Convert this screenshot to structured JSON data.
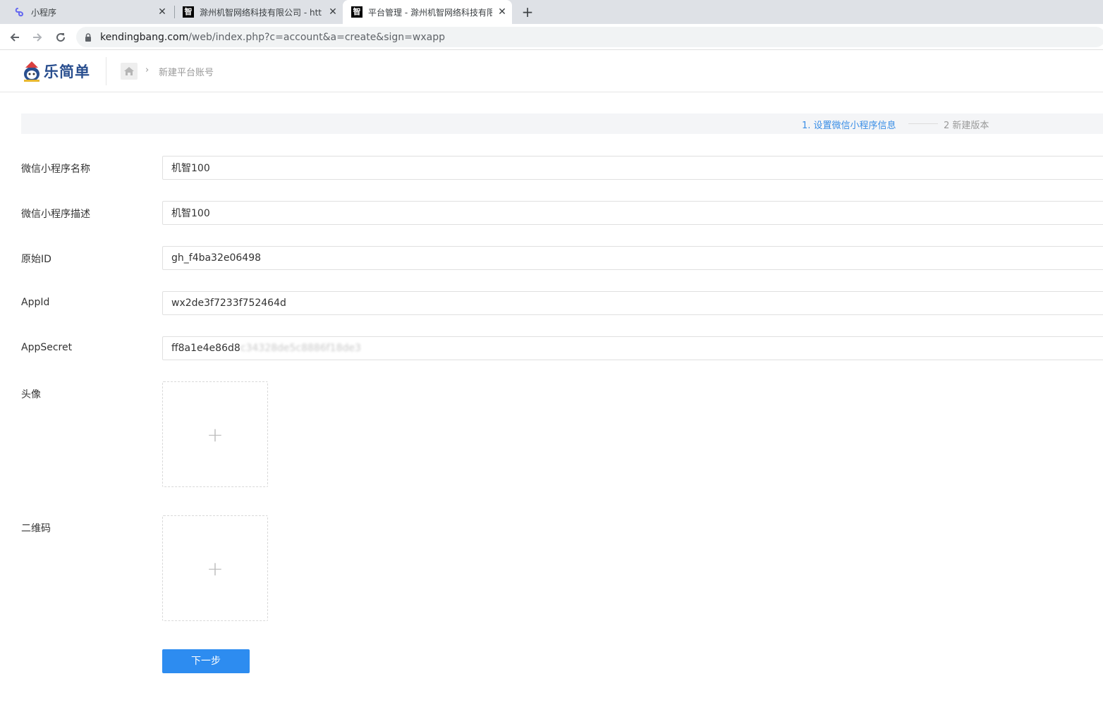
{
  "browser": {
    "tabs": [
      {
        "title": "小程序",
        "icon": "mini-program-icon",
        "active": false
      },
      {
        "title": "滁州机智网络科技有限公司 - htt",
        "icon": "zhi-icon",
        "favicon_char": "智",
        "active": false
      },
      {
        "title": "平台管理 - 滁州机智网络科技有限",
        "icon": "zhi-icon",
        "favicon_char": "智",
        "active": true
      }
    ],
    "new_tab_icon": "plus-icon",
    "url_host": "kendingbang.com",
    "url_path": "/web/index.php?c=account&a=create&sign=wxapp"
  },
  "header": {
    "logo_text": "乐简单",
    "breadcrumb_current": "新建平台账号"
  },
  "steps": {
    "step1": "1. 设置微信小程序信息",
    "step2": "2 新建版本",
    "active_color": "#3a8ee6"
  },
  "form": {
    "name": {
      "label": "微信小程序名称",
      "value": "机智100"
    },
    "description": {
      "label": "微信小程序描述",
      "value": "机智100"
    },
    "original_id": {
      "label": "原始ID",
      "value": "gh_f4ba32e06498"
    },
    "appid": {
      "label": "AppId",
      "value": "wx2de3f7233f752464d"
    },
    "appsecret": {
      "label": "AppSecret",
      "value_visible": "ff8a1e4e86d8",
      "value_blurred": "c34328de5c8886f18de3"
    },
    "avatar": {
      "label": "头像"
    },
    "qrcode": {
      "label": "二维码"
    },
    "next_button": "下一步"
  },
  "colors": {
    "primary": "#2d8cf0",
    "step_active": "#3a8ee6"
  }
}
